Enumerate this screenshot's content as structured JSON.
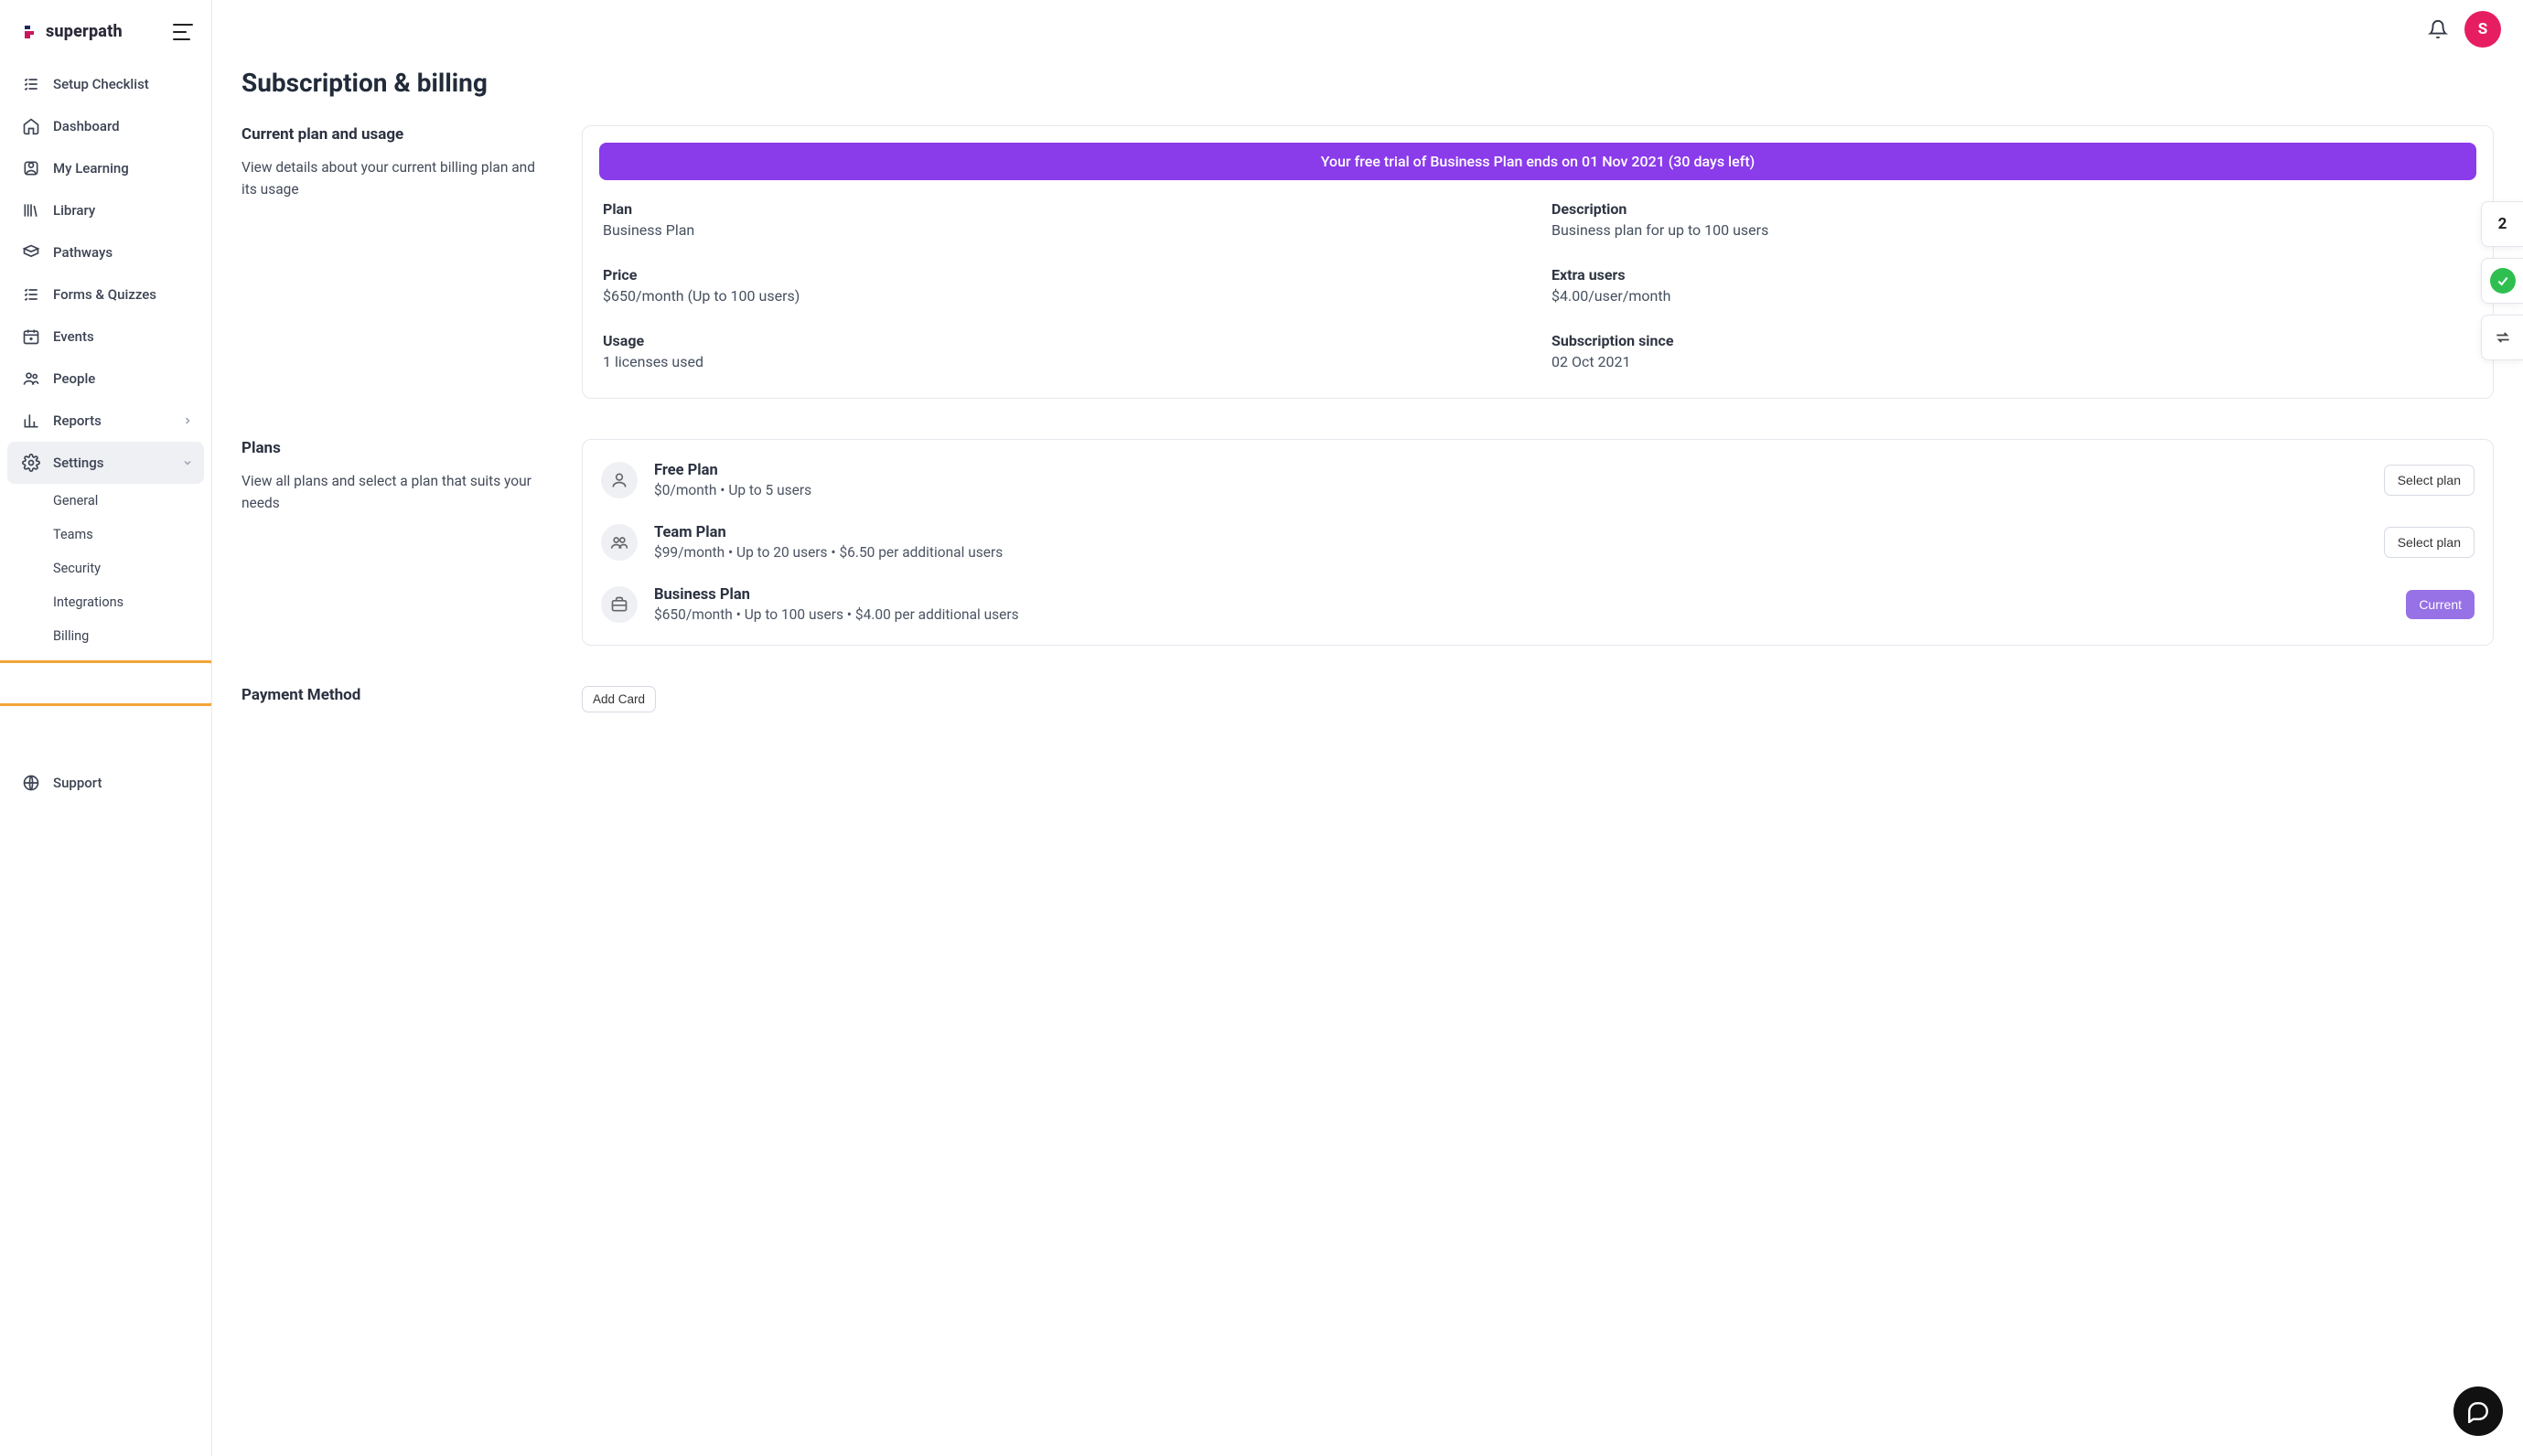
{
  "brand": {
    "name": "superpath"
  },
  "header": {
    "avatar_initial": "S",
    "float_num": "2"
  },
  "sidebar": {
    "items": [
      {
        "label": "Setup Checklist"
      },
      {
        "label": "Dashboard"
      },
      {
        "label": "My Learning"
      },
      {
        "label": "Library"
      },
      {
        "label": "Pathways"
      },
      {
        "label": "Forms & Quizzes"
      },
      {
        "label": "Events"
      },
      {
        "label": "People"
      },
      {
        "label": "Reports"
      },
      {
        "label": "Settings"
      },
      {
        "label": "Support"
      }
    ],
    "settings_sub": [
      {
        "label": "General"
      },
      {
        "label": "Teams"
      },
      {
        "label": "Security"
      },
      {
        "label": "Integrations"
      },
      {
        "label": "Billing"
      }
    ]
  },
  "page": {
    "title": "Subscription & billing",
    "sections": {
      "usage": {
        "heading": "Current plan and usage",
        "desc": "View details about your current billing plan and its usage"
      },
      "plans": {
        "heading": "Plans",
        "desc": "View all plans and select a plan that suits your needs"
      },
      "payment": {
        "heading": "Payment Method"
      }
    }
  },
  "billing": {
    "banner": "Your free trial of Business Plan ends on 01 Nov 2021 (30 days left)",
    "facts": {
      "plan_label": "Plan",
      "plan_value": "Business Plan",
      "desc_label": "Description",
      "desc_value": "Business plan for up to 100 users",
      "price_label": "Price",
      "price_value": "$650/month (Up to 100 users)",
      "extra_label": "Extra users",
      "extra_value": "$4.00/user/month",
      "usage_label": "Usage",
      "usage_value": "1 licenses used",
      "since_label": "Subscription since",
      "since_value": "02 Oct 2021"
    }
  },
  "plans": [
    {
      "name": "Free Plan",
      "line": "$0/month • Up to 5 users",
      "action": "Select plan",
      "is_current": false
    },
    {
      "name": "Team Plan",
      "line": "$99/month • Up to 20 users • $6.50 per additional users",
      "action": "Select plan",
      "is_current": false
    },
    {
      "name": "Business Plan",
      "line": "$650/month • Up to 100 users • $4.00 per additional users",
      "action": "Current",
      "is_current": true
    }
  ],
  "payment": {
    "add_card": "Add Card"
  }
}
